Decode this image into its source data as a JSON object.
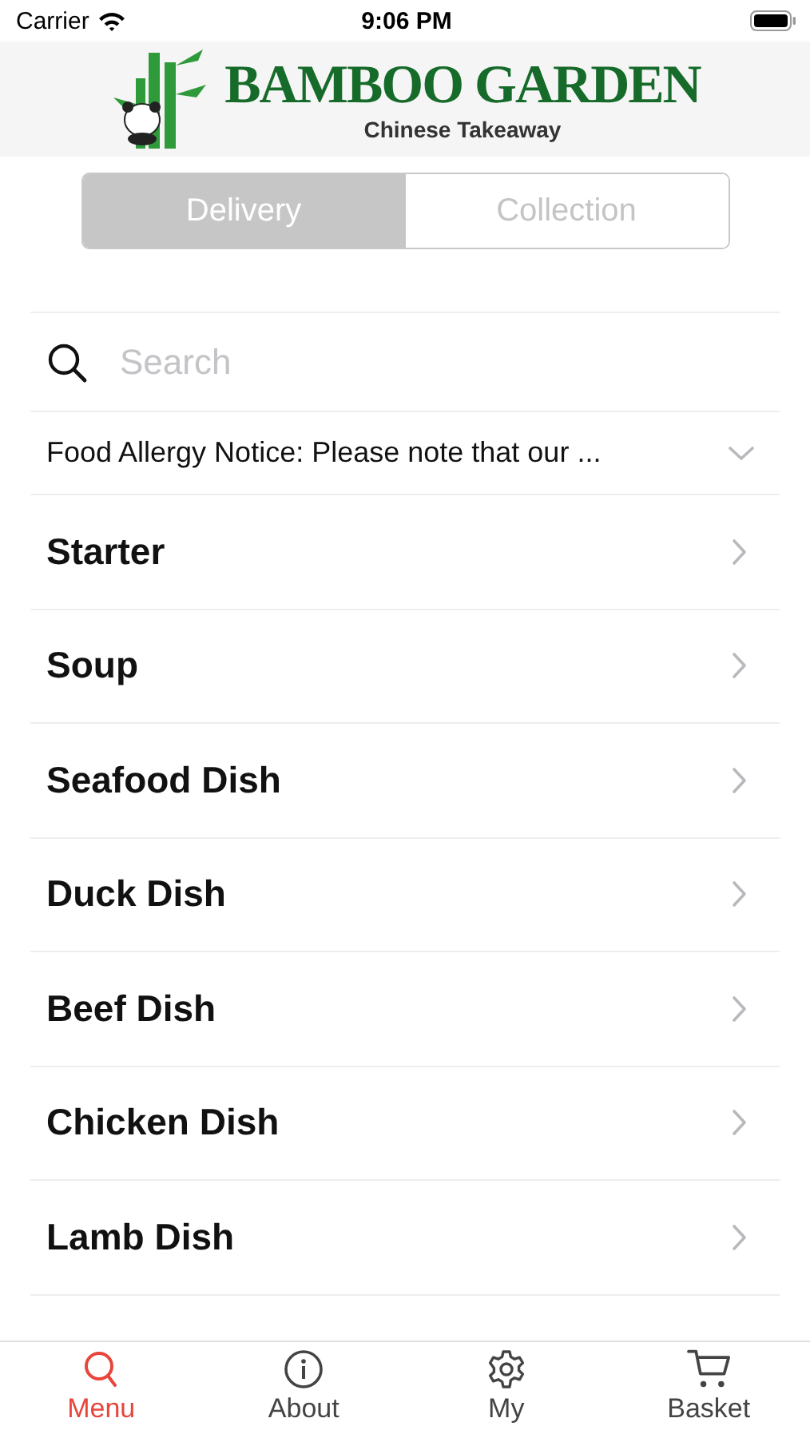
{
  "status_bar": {
    "carrier": "Carrier",
    "time": "9:06 PM"
  },
  "header": {
    "brand": "BAMBOO GARDEN",
    "tagline": "Chinese Takeaway"
  },
  "order_type": [
    {
      "label": "Delivery",
      "selected": true
    },
    {
      "label": "Collection",
      "selected": false
    }
  ],
  "search": {
    "placeholder": "Search"
  },
  "notice": {
    "text": "Food Allergy Notice: Please note that our ...",
    "expanded": false
  },
  "categories": [
    "Starter",
    "Soup",
    "Seafood Dish",
    "Duck Dish",
    "Beef Dish",
    "Chicken Dish",
    "Lamb Dish"
  ],
  "tab_bar": [
    {
      "label": "Menu",
      "kind": "search",
      "selected": true
    },
    {
      "label": "About",
      "kind": "info",
      "selected": false
    },
    {
      "label": "My",
      "kind": "gear",
      "selected": false
    },
    {
      "label": "Basket",
      "kind": "cart",
      "selected": false
    }
  ]
}
